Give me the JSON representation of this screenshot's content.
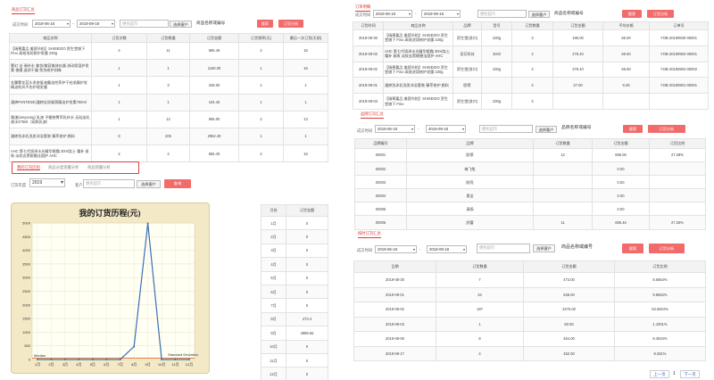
{
  "common": {
    "time_label": "成交时间",
    "date_from": "2019-06-18",
    "date_to": "2019-09-18",
    "dash": "-",
    "customer_placeholder": "便民超市",
    "select_customer": "选择客户",
    "product_placeholder": "商品名称或编号",
    "search": "搜索",
    "order_analysis": "订货分析"
  },
  "p1": {
    "tab": "商品订货汇总",
    "headers": [
      "商品名称",
      "订货次数",
      "订货数量",
      "订货金额",
      "订货频率(天)",
      "最后一次订货(天前)"
    ],
    "rows": [
      [
        "【瑞果嘉品 美国节拍】SHISEIDO 资生堂旗下 Fino 高效浓润修护发膜 230g",
        "4",
        "11",
        "695.46",
        "2",
        "15"
      ],
      [
        "蒙幻 苦 瑞补水 美妆/美容美体仪器 流动保湿护发素 夜膜 滋润干燥 免洗修护润嗨",
        "1",
        "1",
        "1160.00",
        "1",
        "16"
      ],
      [
        "金翼蒙花蕊头发修复液露油控养护干枯毛躁护发精油吹风不伤护理发膜",
        "1",
        "3",
        "348.00",
        "1",
        "1"
      ],
      [
        "潘婷PANTENE)潘婷丝质顺滑精油护发素750ml",
        "1",
        "1",
        "104.40",
        "1",
        "1"
      ],
      [
        "雅漾(amyoung) 乳液 子植物菁萃乳补水 无硅油乳液水375ml（润肤乳液）",
        "1",
        "12",
        "696.00",
        "2",
        "13"
      ],
      [
        "潘婷洗沐乳洗发沐浴套装 臻萃修护 颜料",
        "8",
        "205",
        "2962.40",
        "1",
        "1"
      ],
      [
        "AHC 第七代润泽水光精华眼霜 30ml女士 霜补 紧致 淡纹去黑眼圈法国护 AHC",
        "2",
        "4",
        "556.40",
        "2",
        "16"
      ]
    ],
    "subtabs": [
      "我的订货历程",
      "商品分类销量分析",
      "商品销量分析"
    ],
    "year_label": "订货年度",
    "year": "2019",
    "customer_label": "客户",
    "query": "查询",
    "month_headers": [
      "月份",
      "订货金额"
    ],
    "months": [
      [
        "1月",
        "0"
      ],
      [
        "2月",
        "0"
      ],
      [
        "3月",
        "0"
      ],
      [
        "4月",
        "0"
      ],
      [
        "5月",
        "0"
      ],
      [
        "6月",
        "0"
      ],
      [
        "7月",
        "0"
      ],
      [
        "8月",
        "473.4"
      ],
      [
        "9月",
        "4989.66"
      ],
      [
        "10月",
        "0"
      ],
      [
        "11月",
        "0"
      ],
      [
        "12月",
        "0"
      ]
    ]
  },
  "chart_data": {
    "type": "line",
    "title": "我的订货历程(元)",
    "categories": [
      "1月",
      "2月",
      "3月",
      "4月",
      "5月",
      "6月",
      "7月",
      "8月",
      "9月",
      "10月",
      "11月",
      "12月"
    ],
    "series": [
      {
        "name": "",
        "values": [
          0,
          0,
          0,
          0,
          0,
          0,
          0,
          473.4,
          4989.66,
          0,
          0,
          0
        ]
      }
    ],
    "ylim": [
      0,
      5000
    ],
    "yticks": [
      0,
      500,
      1000,
      1500,
      2000,
      2500,
      3000,
      3500,
      4000,
      4500,
      5000
    ],
    "annotations": [
      "Median",
      "Standard Deviation"
    ],
    "colors": {
      "line": "#3a6fb5",
      "bg": "#fffff4",
      "frame": "#f3e9c6"
    }
  },
  "p2": {
    "tab": "订单明细",
    "headers": [
      "订货时间",
      "商品名称",
      "品牌",
      "型号",
      "订货数量",
      "订货金额",
      "平均价格",
      "订单号"
    ],
    "rows": [
      [
        "2019-08-30",
        "【瑞果嘉品 美国节拍】SHISEIDO 资生堂旗下 Fino 高效浓润修护发膜 230g",
        "资生堂(进口)",
        "230g",
        "3",
        "195.00",
        "65.00",
        "YOB-20190830-00001"
      ],
      [
        "2019-09-02",
        "AHC 第七代润泽水光精华眼霜 30ml女士 霜补 紧致 淡纹去黑眼圈法国护 AHC",
        "奇芳科技",
        "30ml",
        "2",
        "278.40",
        "69.60",
        "YOB-20190902-00001"
      ],
      [
        "2019-09-02",
        "【瑞果嘉品 美国节拍】SHISEIDO 资生堂旗下 Fino 高效浓润修护发膜 230g",
        "资生堂(进口)",
        "230g",
        "4",
        "278.40",
        "69.60",
        "YOB-20190902-00002"
      ],
      [
        "2019-09-01",
        "潘婷洗沐乳洗发沐浴套装 臻萃修护 颜料",
        "欧莱",
        "",
        "3",
        "27.00",
        "9.28",
        "YOB-20190901-00001"
      ],
      [
        "2019-09-03",
        "【瑞果嘉品 美国节拍】SHISEIDO 资生堂旗下 Fino",
        "资生堂(进口)",
        "230g",
        "3",
        "",
        "",
        ""
      ]
    ]
  },
  "p3": {
    "tab": "品牌订货汇总",
    "headers": [
      "品牌编号",
      "品牌",
      "订货数量",
      "订货金额",
      "订货比例"
    ],
    "rows": [
      [
        "00001",
        "欧莱",
        "12",
        "696.00",
        "27.28%"
      ],
      [
        "00002",
        "梅飞兔",
        "",
        "0.00",
        ""
      ],
      [
        "00003",
        "欧亮",
        "",
        "0.00",
        ""
      ],
      [
        "00004",
        "奥宝",
        "",
        "0.00",
        ""
      ],
      [
        "00005",
        "清扬",
        "",
        "0.00",
        ""
      ],
      [
        "00006",
        "舒蕾",
        "11",
        "695.46",
        "27.26%"
      ]
    ],
    "product_placeholder": "品牌名称或编号"
  },
  "p4": {
    "tab": "按时订货汇总",
    "headers": [
      "日期",
      "订货数量",
      "订货金额",
      "订货比例"
    ],
    "rows": [
      [
        "2019-08-30",
        "7",
        "473.00",
        "8.6654%"
      ],
      [
        "2019-09-01",
        "34",
        "538.00",
        "9.8552%"
      ],
      [
        "2019-09-02",
        "187",
        "3475.00",
        "63.6604%"
      ],
      [
        "2019-09-03",
        "1",
        "60.00",
        "1.1001%"
      ],
      [
        "2019-09-05",
        "8",
        "464.00",
        "8.4934%"
      ],
      [
        "2019-09-17",
        "4",
        "452.00",
        "8.281%"
      ]
    ],
    "prev": "上一页",
    "page": "1",
    "next": "下一页"
  }
}
